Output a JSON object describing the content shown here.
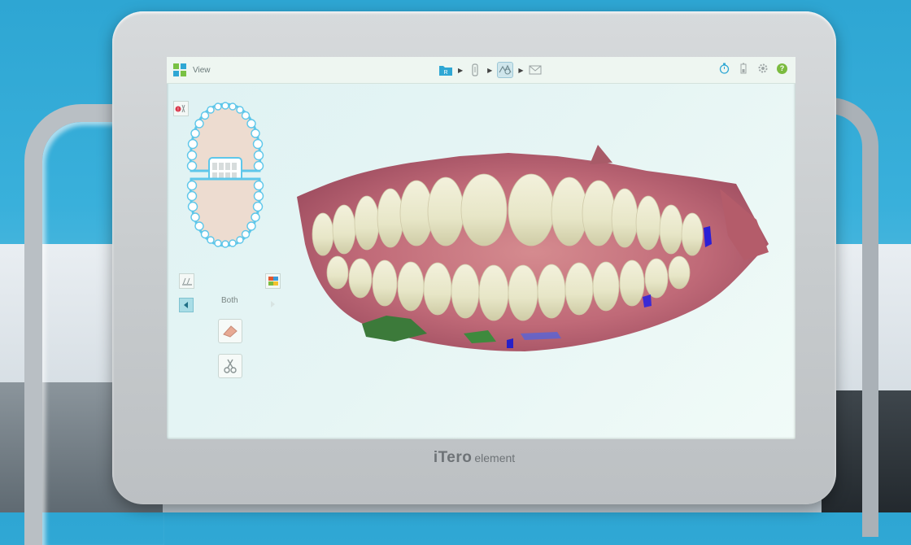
{
  "app": {
    "view_label": "View",
    "arch_selection_label": "Both",
    "brand_name": "iTero",
    "brand_model": "element"
  },
  "colors": {
    "accent": "#2fa7d4",
    "help": "#7bbb3f",
    "jaw_outline": "#5ec7ea",
    "screen_bg": "#e3f3f3"
  },
  "workflow": {
    "steps": [
      {
        "icon": "rx-folder-icon",
        "glyph": "R",
        "state": "done"
      },
      {
        "icon": "scan-wand-icon",
        "state": "done"
      },
      {
        "icon": "view-model-icon",
        "state": "active"
      },
      {
        "icon": "send-envelope-icon",
        "state": "pending"
      }
    ]
  },
  "toolbar_right": [
    "timer-icon",
    "battery-icon",
    "settings-gear-icon",
    "help-icon"
  ],
  "left_tools": [
    "upper-jaw-error-icon",
    "lower-jaw-icon",
    "bite-view-icon",
    "eraser-icon",
    "trim-scissors-icon"
  ]
}
